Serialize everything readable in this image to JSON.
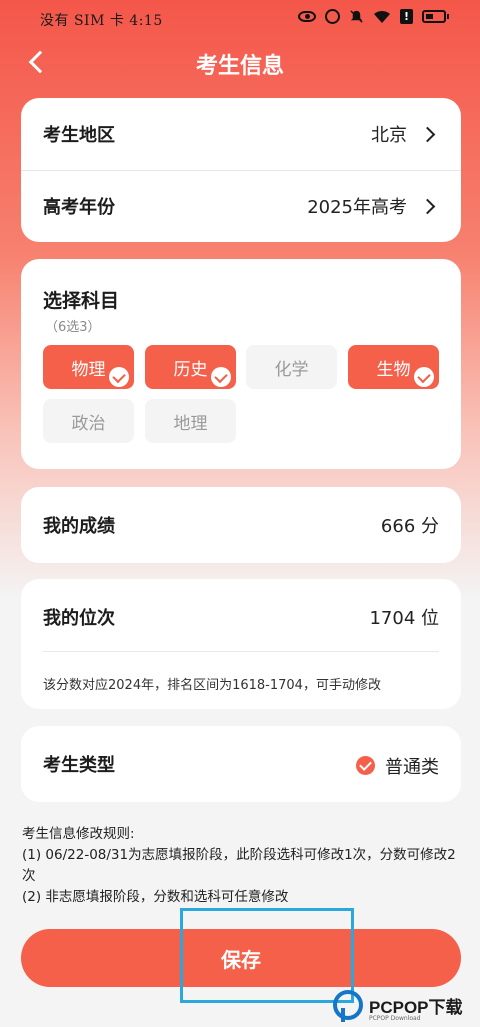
{
  "status_bar": {
    "left_text": "没有 SIM 卡 4:15"
  },
  "nav": {
    "title": "考生信息"
  },
  "region_card": {
    "rows": [
      {
        "label": "考生地区",
        "value": "北京"
      },
      {
        "label": "高考年份",
        "value": "2025年高考"
      }
    ]
  },
  "subjects": {
    "title": "选择科目",
    "hint": "（6选3）",
    "chips": [
      {
        "label": "物理",
        "selected": true
      },
      {
        "label": "历史",
        "selected": true
      },
      {
        "label": "化学",
        "selected": false
      },
      {
        "label": "生物",
        "selected": true
      },
      {
        "label": "政治",
        "selected": false
      },
      {
        "label": "地理",
        "selected": false
      }
    ]
  },
  "score": {
    "label": "我的成绩",
    "value": "666 分"
  },
  "rank": {
    "label": "我的位次",
    "value": "1704 位",
    "note": "该分数对应2024年，排名区间为1618-1704，可手动修改"
  },
  "type": {
    "label": "考生类型",
    "option": "普通类"
  },
  "rules": {
    "title": "考生信息修改规则:",
    "line1": "(1) 06/22-08/31为志愿填报阶段，此阶段选科可修改1次，分数可修改2次",
    "line2": "(2) 非志愿填报阶段，分数和选科可任意修改"
  },
  "save_label": "保存",
  "watermark": {
    "text": "PCPOP下载",
    "sub": "PCPOP Download"
  },
  "colors": {
    "accent": "#f4604a",
    "highlight": "#2aa7dc"
  }
}
